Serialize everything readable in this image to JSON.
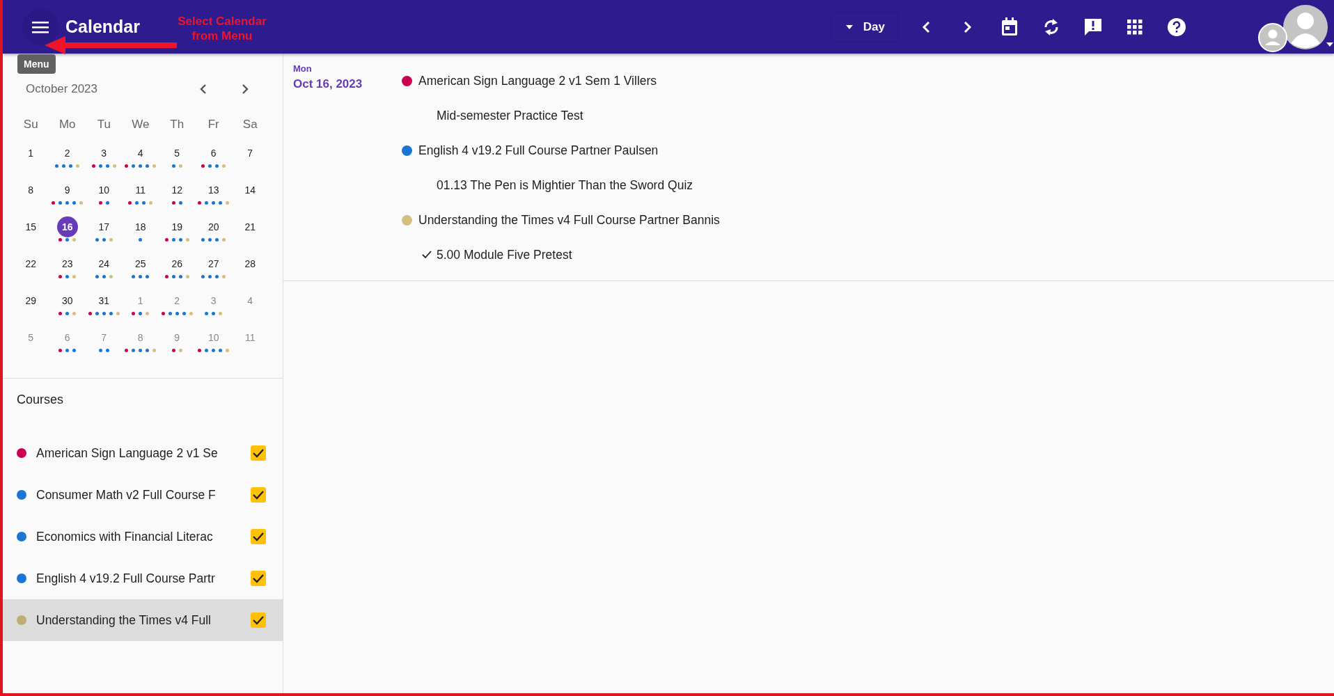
{
  "header": {
    "title": "Calendar",
    "view_button": "Day",
    "annotation": "Select Calendar from Menu"
  },
  "tooltip": "Menu",
  "mini_calendar": {
    "month": "October 2023",
    "weekdays": [
      "Su",
      "Mo",
      "Tu",
      "We",
      "Th",
      "Fr",
      "Sa"
    ],
    "weeks": [
      [
        {
          "day": "1",
          "outside": false,
          "selected": false
        },
        {
          "day": "2",
          "outside": false,
          "selected": false,
          "dots": [
            {
              "color": "#1976d2"
            },
            {
              "color": "#1976d2"
            },
            {
              "color": "#1976d2"
            },
            {
              "color": "#d4bf80"
            }
          ]
        },
        {
          "day": "3",
          "outside": false,
          "selected": false,
          "dots": [
            {
              "color": "#cc0052"
            },
            {
              "color": "#1976d2"
            },
            {
              "color": "#1976d2"
            },
            {
              "color": "#d4bf80"
            }
          ]
        },
        {
          "day": "4",
          "outside": false,
          "selected": false,
          "dots": [
            {
              "color": "#cc0052"
            },
            {
              "color": "#1976d2"
            },
            {
              "color": "#1976d2"
            },
            {
              "color": "#1976d2"
            },
            {
              "color": "#d4bf80"
            }
          ]
        },
        {
          "day": "5",
          "outside": false,
          "selected": false,
          "dots": [
            {
              "color": "#1976d2"
            },
            {
              "color": "#d4bf80"
            }
          ]
        },
        {
          "day": "6",
          "outside": false,
          "selected": false,
          "dots": [
            {
              "color": "#cc0052"
            },
            {
              "color": "#1976d2"
            },
            {
              "color": "#1976d2"
            },
            {
              "color": "#d4bf80"
            }
          ]
        },
        {
          "day": "7",
          "outside": false,
          "selected": false
        }
      ],
      [
        {
          "day": "8",
          "outside": false,
          "selected": false
        },
        {
          "day": "9",
          "outside": false,
          "selected": false,
          "dots": [
            {
              "color": "#cc0052"
            },
            {
              "color": "#1976d2"
            },
            {
              "color": "#1976d2"
            },
            {
              "color": "#1976d2"
            },
            {
              "color": "#d4bf80"
            }
          ]
        },
        {
          "day": "10",
          "outside": false,
          "selected": false,
          "dots": [
            {
              "color": "#cc0052"
            },
            {
              "color": "#1976d2"
            }
          ]
        },
        {
          "day": "11",
          "outside": false,
          "selected": false,
          "dots": [
            {
              "color": "#cc0052"
            },
            {
              "color": "#1976d2"
            },
            {
              "color": "#1976d2"
            },
            {
              "color": "#d4bf80"
            }
          ]
        },
        {
          "day": "12",
          "outside": false,
          "selected": false,
          "dots": [
            {
              "color": "#cc0052"
            },
            {
              "color": "#1976d2"
            }
          ]
        },
        {
          "day": "13",
          "outside": false,
          "selected": false,
          "dots": [
            {
              "color": "#cc0052"
            },
            {
              "color": "#1976d2"
            },
            {
              "color": "#1976d2"
            },
            {
              "color": "#1976d2"
            },
            {
              "color": "#d4bf80"
            }
          ]
        },
        {
          "day": "14",
          "outside": false,
          "selected": false
        }
      ],
      [
        {
          "day": "15",
          "outside": false,
          "selected": false
        },
        {
          "day": "16",
          "outside": false,
          "selected": true,
          "dots": [
            {
              "color": "#cc0052"
            },
            {
              "color": "#1976d2"
            },
            {
              "color": "#d4bf80"
            }
          ]
        },
        {
          "day": "17",
          "outside": false,
          "selected": false,
          "dots": [
            {
              "color": "#1976d2"
            },
            {
              "color": "#1976d2"
            },
            {
              "color": "#d4bf80"
            }
          ]
        },
        {
          "day": "18",
          "outside": false,
          "selected": false,
          "dots": [
            {
              "color": "#1976d2"
            }
          ]
        },
        {
          "day": "19",
          "outside": false,
          "selected": false,
          "dots": [
            {
              "color": "#cc0052"
            },
            {
              "color": "#1976d2"
            },
            {
              "color": "#1976d2"
            },
            {
              "color": "#d4bf80"
            }
          ]
        },
        {
          "day": "20",
          "outside": false,
          "selected": false,
          "dots": [
            {
              "color": "#1976d2"
            },
            {
              "color": "#1976d2"
            },
            {
              "color": "#1976d2"
            },
            {
              "color": "#d4bf80"
            }
          ]
        },
        {
          "day": "21",
          "outside": false,
          "selected": false
        }
      ],
      [
        {
          "day": "22",
          "outside": false,
          "selected": false
        },
        {
          "day": "23",
          "outside": false,
          "selected": false,
          "dots": [
            {
              "color": "#cc0052"
            },
            {
              "color": "#1976d2"
            },
            {
              "color": "#d4bf80"
            }
          ]
        },
        {
          "day": "24",
          "outside": false,
          "selected": false,
          "dots": [
            {
              "color": "#1976d2"
            },
            {
              "color": "#1976d2"
            },
            {
              "color": "#d4bf80"
            }
          ]
        },
        {
          "day": "25",
          "outside": false,
          "selected": false,
          "dots": [
            {
              "color": "#1976d2"
            },
            {
              "color": "#1976d2"
            },
            {
              "color": "#1976d2"
            }
          ]
        },
        {
          "day": "26",
          "outside": false,
          "selected": false,
          "dots": [
            {
              "color": "#cc0052"
            },
            {
              "color": "#1976d2"
            },
            {
              "color": "#1976d2"
            },
            {
              "color": "#d4bf80"
            }
          ]
        },
        {
          "day": "27",
          "outside": false,
          "selected": false,
          "dots": [
            {
              "color": "#1976d2"
            },
            {
              "color": "#1976d2"
            },
            {
              "color": "#1976d2"
            },
            {
              "color": "#d4bf80"
            }
          ]
        },
        {
          "day": "28",
          "outside": false,
          "selected": false
        }
      ],
      [
        {
          "day": "29",
          "outside": false,
          "selected": false
        },
        {
          "day": "30",
          "outside": false,
          "selected": false,
          "dots": [
            {
              "color": "#cc0052"
            },
            {
              "color": "#1976d2"
            },
            {
              "color": "#d4bf80"
            }
          ]
        },
        {
          "day": "31",
          "outside": false,
          "selected": false,
          "dots": [
            {
              "color": "#cc0052"
            },
            {
              "color": "#1976d2"
            },
            {
              "color": "#1976d2"
            },
            {
              "color": "#1976d2"
            },
            {
              "color": "#d4bf80"
            }
          ]
        },
        {
          "day": "1",
          "outside": true,
          "selected": false,
          "dots": [
            {
              "color": "#cc0052"
            },
            {
              "color": "#1976d2"
            },
            {
              "color": "#d4bf80"
            }
          ]
        },
        {
          "day": "2",
          "outside": true,
          "selected": false,
          "dots": [
            {
              "color": "#cc0052"
            },
            {
              "color": "#1976d2"
            },
            {
              "color": "#1976d2"
            },
            {
              "color": "#1976d2"
            },
            {
              "color": "#d4bf80"
            }
          ]
        },
        {
          "day": "3",
          "outside": true,
          "selected": false,
          "dots": [
            {
              "color": "#1976d2"
            },
            {
              "color": "#1976d2"
            },
            {
              "color": "#d4bf80"
            }
          ]
        },
        {
          "day": "4",
          "outside": true,
          "selected": false
        }
      ],
      [
        {
          "day": "5",
          "outside": true,
          "selected": false
        },
        {
          "day": "6",
          "outside": true,
          "selected": false,
          "dots": [
            {
              "color": "#cc0052"
            },
            {
              "color": "#1976d2"
            },
            {
              "color": "#1976d2"
            }
          ]
        },
        {
          "day": "7",
          "outside": true,
          "selected": false,
          "dots": [
            {
              "color": "#1976d2"
            },
            {
              "color": "#1976d2"
            }
          ]
        },
        {
          "day": "8",
          "outside": true,
          "selected": false,
          "dots": [
            {
              "color": "#cc0052"
            },
            {
              "color": "#1976d2"
            },
            {
              "color": "#1976d2"
            },
            {
              "color": "#1976d2"
            },
            {
              "color": "#d4bf80"
            }
          ]
        },
        {
          "day": "9",
          "outside": true,
          "selected": false,
          "dots": [
            {
              "color": "#cc0052"
            },
            {
              "color": "#d4bf80"
            }
          ]
        },
        {
          "day": "10",
          "outside": true,
          "selected": false,
          "dots": [
            {
              "color": "#cc0052"
            },
            {
              "color": "#1976d2"
            },
            {
              "color": "#1976d2"
            },
            {
              "color": "#1976d2"
            },
            {
              "color": "#d4bf80"
            }
          ]
        },
        {
          "day": "11",
          "outside": true,
          "selected": false
        }
      ]
    ]
  },
  "courses": {
    "title": "Courses",
    "items": [
      {
        "name": "American Sign Language 2 v1 Se",
        "color": "#cc0052",
        "checked": true,
        "selected": false
      },
      {
        "name": "Consumer Math v2 Full Course F",
        "color": "#1976d2",
        "checked": true,
        "selected": false
      },
      {
        "name": "Economics with Financial Literac",
        "color": "#1976d2",
        "checked": true,
        "selected": false
      },
      {
        "name": "English 4 v19.2 Full Course Partr",
        "color": "#1976d2",
        "checked": true,
        "selected": false
      },
      {
        "name": "Understanding the Times v4 Full",
        "color": "#bfae72",
        "checked": true,
        "selected": true
      }
    ]
  },
  "agenda": {
    "weekday": "Mon",
    "date": "Oct 16, 2023",
    "events": [
      {
        "course": "American Sign Language 2 v1 Sem 1 Villers",
        "color": "#cc0052",
        "items": [
          {
            "title": "Mid-semester Practice Test",
            "done": false
          }
        ]
      },
      {
        "course": "English 4 v19.2 Full Course Partner Paulsen",
        "color": "#1976d2",
        "items": [
          {
            "title": "01.13 The Pen is Mightier Than the Sword Quiz",
            "done": false
          }
        ]
      },
      {
        "course": "Understanding the Times v4 Full Course Partner Bannis",
        "color": "#d4bf80",
        "items": [
          {
            "title": "5.00 Module Five Pretest",
            "done": true
          }
        ]
      }
    ]
  }
}
